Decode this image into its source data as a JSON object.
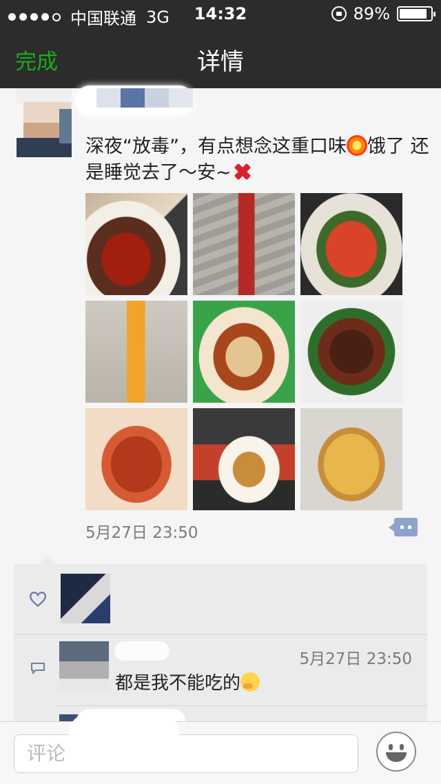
{
  "status_bar": {
    "carrier": "中国联通",
    "network": "3G",
    "time": "14:32",
    "battery_text": "89%",
    "battery_level": 0.89,
    "signal_bars": 4
  },
  "nav": {
    "done_label": "完成",
    "title": "详情"
  },
  "post": {
    "text_before_emoji1": "深夜“放毒”，有点想念这重口味",
    "emoji1": "collision-emoji",
    "text_after_emoji1": "饿了 还是睡觉去了～安~",
    "emoji2": "anger-symbol-emoji",
    "photos": [
      "stinky-tofu",
      "spicy-skewer",
      "crayfish-dish",
      "spiral-potato",
      "steamed-fish",
      "stir-fry-peppers",
      "roasted-chicken",
      "fish-balls-cup",
      "pizza"
    ],
    "timestamp": "5月27日 23:50"
  },
  "interactions": {
    "comment": {
      "time": "5月27日 23:50",
      "text": "都是我不能吃的",
      "emoji": "thinking-face-emoji"
    }
  },
  "input_bar": {
    "placeholder": "评论"
  },
  "colors": {
    "nav_bg": "#2c2c2c",
    "done_green": "#1aad19",
    "comment_button": "#8da3cb",
    "page_bg": "#f5f5f5",
    "interaction_bg": "#ebebeb"
  }
}
